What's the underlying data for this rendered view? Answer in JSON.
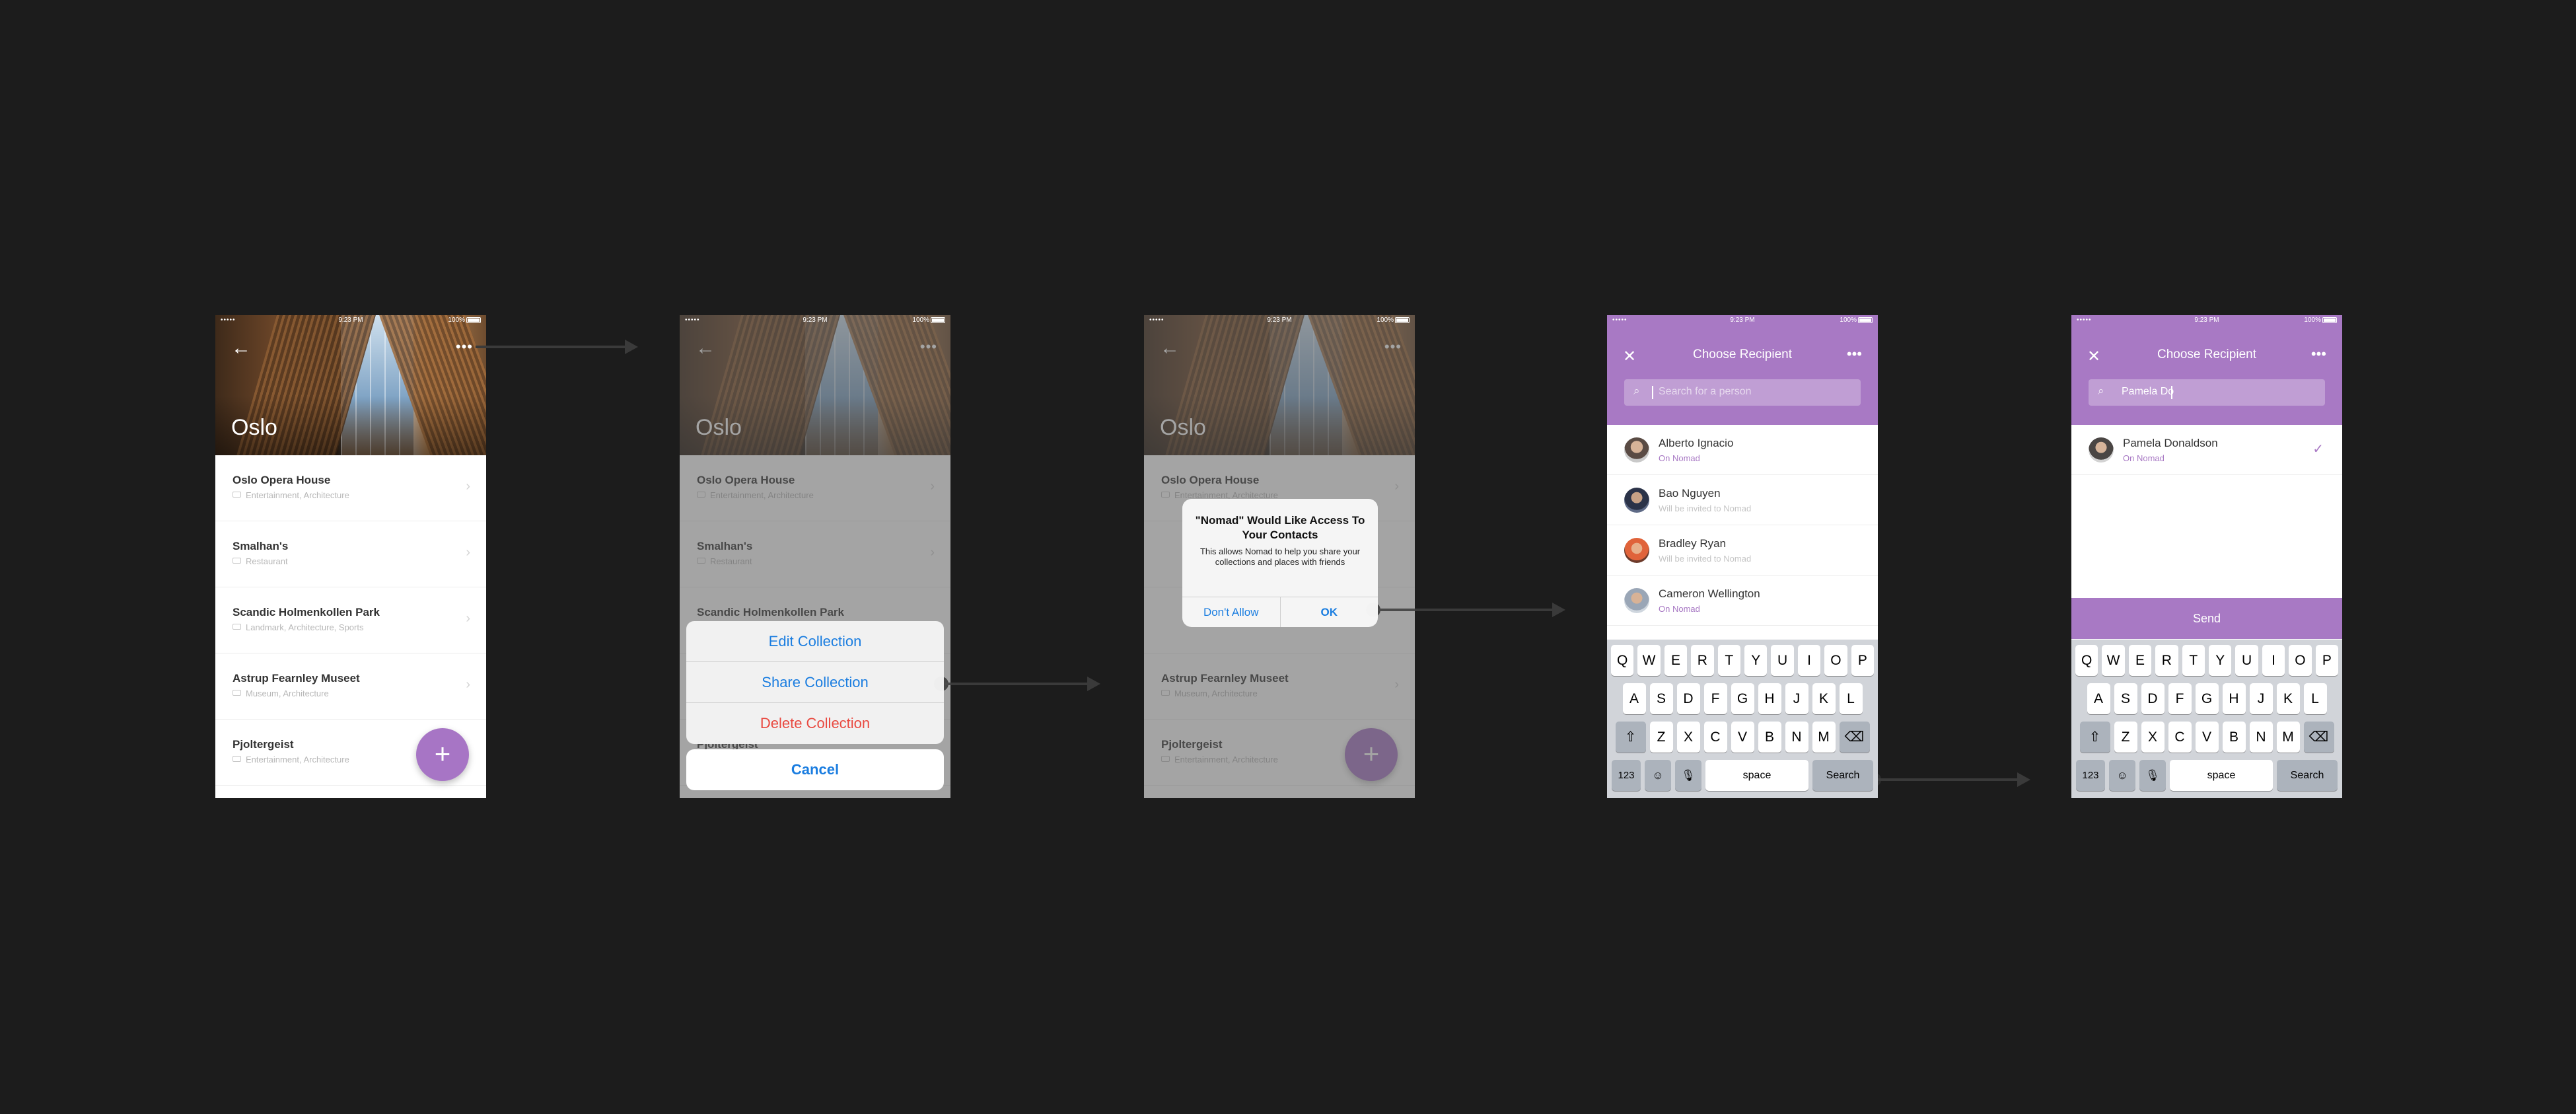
{
  "status": {
    "dots": "•••••",
    "time": "9:23 PM",
    "battery": "100%"
  },
  "city": "Oslo",
  "places": [
    {
      "title": "Oslo Opera House",
      "tags": "Entertainment, Architecture"
    },
    {
      "title": "Smalhan's",
      "tags": "Restaurant"
    },
    {
      "title": "Scandic Holmenkollen Park",
      "tags": "Landmark, Architecture, Sports"
    },
    {
      "title": "Astrup Fearnley Museet",
      "tags": "Museum, Architecture"
    },
    {
      "title": "Pjoltergeist",
      "tags": "Entertainment, Architecture"
    }
  ],
  "icons": {
    "back": "←",
    "more": "•••",
    "chevron": "›",
    "fab": "+",
    "close": "✕",
    "search": "⌕",
    "check": "✓"
  },
  "action_sheet": {
    "edit": "Edit Collection",
    "share": "Share Collection",
    "delete": "Delete Collection",
    "cancel": "Cancel"
  },
  "alert": {
    "title": "\"Nomad\" Would Like Access To Your Contacts",
    "message": "This allows Nomad to help you share your collections and places with friends",
    "deny": "Don't Allow",
    "ok": "OK"
  },
  "recipient": {
    "title": "Choose Recipient",
    "search_placeholder": "Search for a person",
    "search_value": "Pamela Do",
    "send": "Send",
    "contacts": [
      {
        "name": "Alberto Ignacio",
        "status": "On Nomad"
      },
      {
        "name": "Bao Nguyen",
        "status": "Will be invited to Nomad"
      },
      {
        "name": "Bradley Ryan",
        "status": "Will be invited to Nomad"
      },
      {
        "name": "Cameron Wellington",
        "status": "On Nomad"
      }
    ],
    "result": {
      "name": "Pamela Donaldson",
      "status": "On Nomad"
    }
  },
  "keyboard": {
    "row1": [
      "Q",
      "W",
      "E",
      "R",
      "T",
      "Y",
      "U",
      "I",
      "O",
      "P"
    ],
    "row2": [
      "A",
      "S",
      "D",
      "F",
      "G",
      "H",
      "J",
      "K",
      "L"
    ],
    "row3": [
      "Z",
      "X",
      "C",
      "V",
      "B",
      "N",
      "M"
    ],
    "k123": "123",
    "space": "space",
    "search": "Search",
    "shift": "⇧",
    "delete": "⌫",
    "emoji": "☺",
    "mic": "🎙"
  },
  "colors": {
    "accent": "#a879c4",
    "link": "#1a7de0",
    "destructive": "#e94a41",
    "background": "#1c1c1c"
  }
}
